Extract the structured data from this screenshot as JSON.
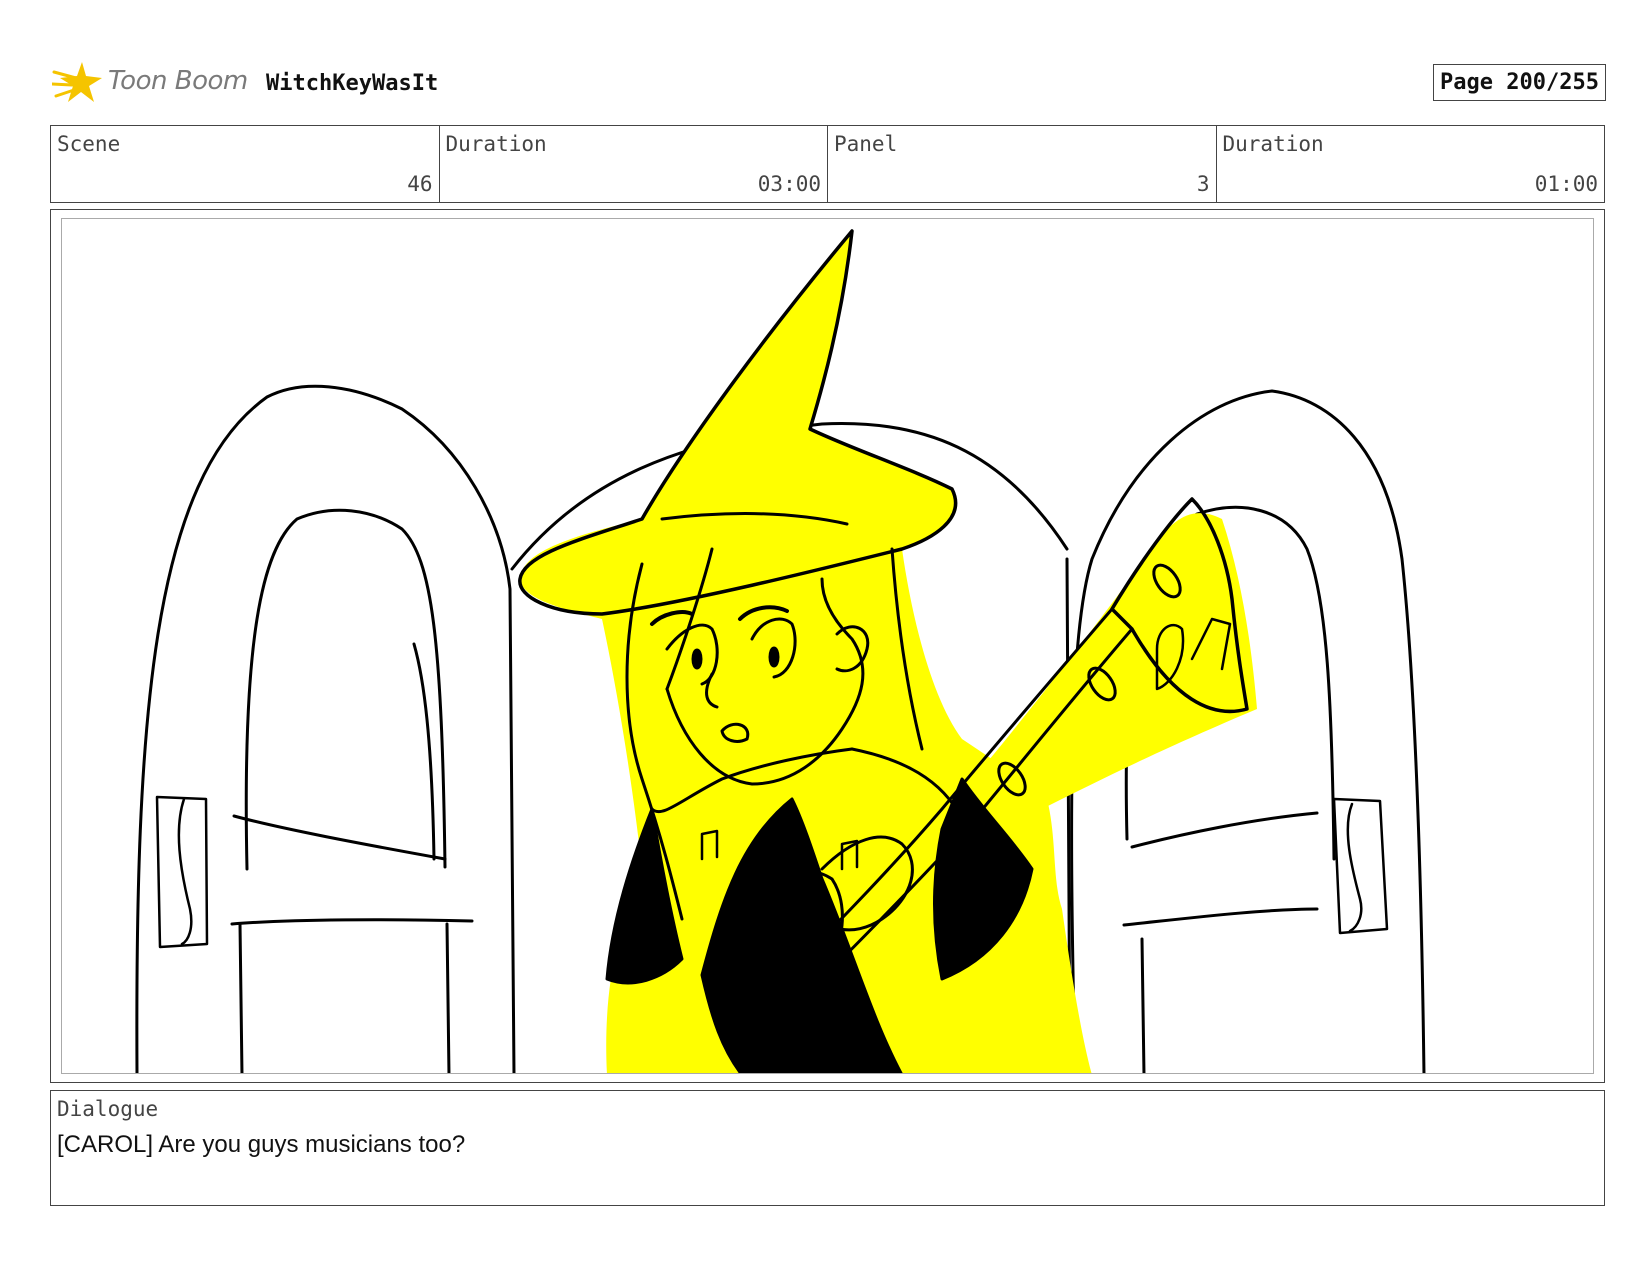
{
  "header": {
    "logo_text": "Toon Boom",
    "project_title": "WitchKeyWasIt",
    "page_label": "Page 200/255"
  },
  "info": {
    "scene_label": "Scene",
    "scene_value": "46",
    "scene_duration_label": "Duration",
    "scene_duration_value": "03:00",
    "panel_label": "Panel",
    "panel_value": "3",
    "panel_duration_label": "Duration",
    "panel_duration_value": "01:00"
  },
  "dialogue": {
    "label": "Dialogue",
    "text": "[CAROL] Are you guys musicians too?"
  },
  "colors": {
    "highlight": "#ffff00",
    "ink": "#000000",
    "logo_star": "#f5c400"
  },
  "icons": {
    "logo": "toon-boom-star-icon"
  }
}
